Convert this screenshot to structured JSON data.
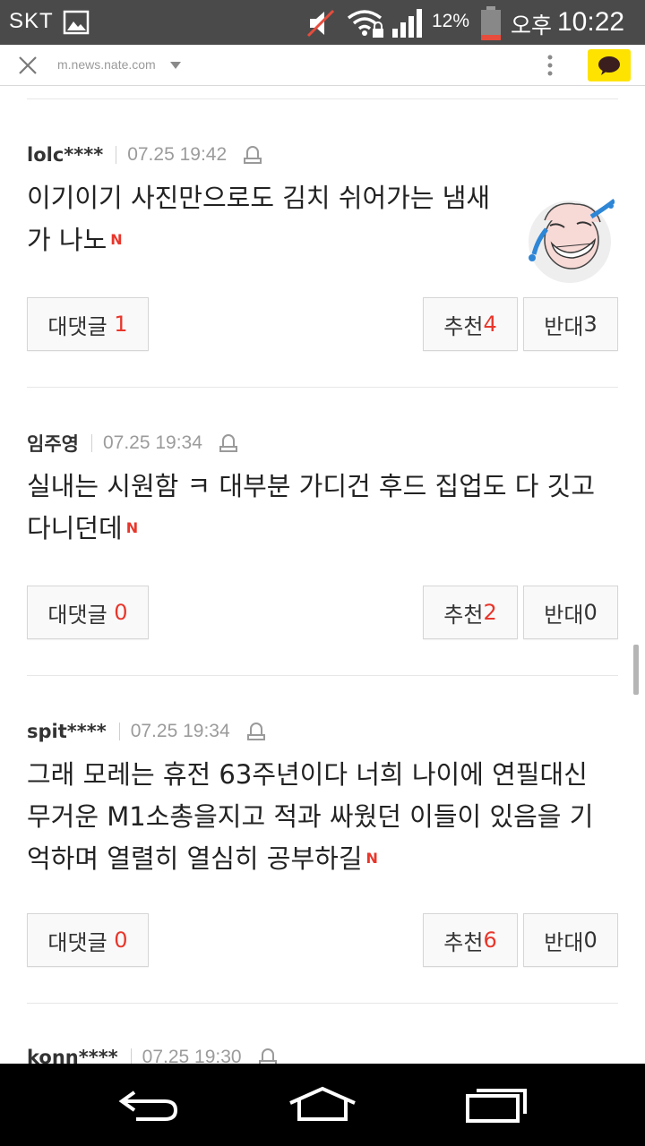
{
  "status_bar": {
    "carrier": "SKT",
    "battery_percent": "12%",
    "ampm": "오후",
    "time": "10:22"
  },
  "browser": {
    "url": "m.news.nate.com"
  },
  "comments": [
    {
      "user": "lolc****",
      "time": "07.25 19:42",
      "text_lines": [
        "이기이기 사진만으로도 김치 쉬어가는 냄새",
        "가 나노"
      ],
      "new_badge": "N",
      "reply_label": "대댓글",
      "reply_count": "1",
      "like_label": "추천",
      "like_count": "4",
      "dislike_label": "반대",
      "dislike_count": "3",
      "has_avatar": true
    },
    {
      "user": "임주영",
      "time": "07.25 19:34",
      "text_lines": [
        "실내는 시원함 ㅋ 대부분 가디건 후드 집업도 다 깃고",
        "다니던데"
      ],
      "new_badge": "N",
      "reply_label": "대댓글",
      "reply_count": "0",
      "like_label": "추천",
      "like_count": "2",
      "dislike_label": "반대",
      "dislike_count": "0"
    },
    {
      "user": "spit****",
      "time": "07.25 19:34",
      "text_lines": [
        "그래 모레는 휴전 63주년이다 너희 나이에 연필대신",
        "무거운 M1소총을지고 적과 싸웠던 이들이 있음을 기",
        "억하며 열렬히 열심히 공부하길"
      ],
      "new_badge": "N",
      "reply_label": "대댓글",
      "reply_count": "0",
      "like_label": "추천",
      "like_count": "6",
      "dislike_label": "반대",
      "dislike_count": "0"
    },
    {
      "user": "konn****",
      "time": "07.25 19:30"
    }
  ],
  "colors": {
    "accent_red": "#e8362b",
    "kakao_yellow": "#ffe300",
    "status_bar": "#4a4a4a"
  }
}
